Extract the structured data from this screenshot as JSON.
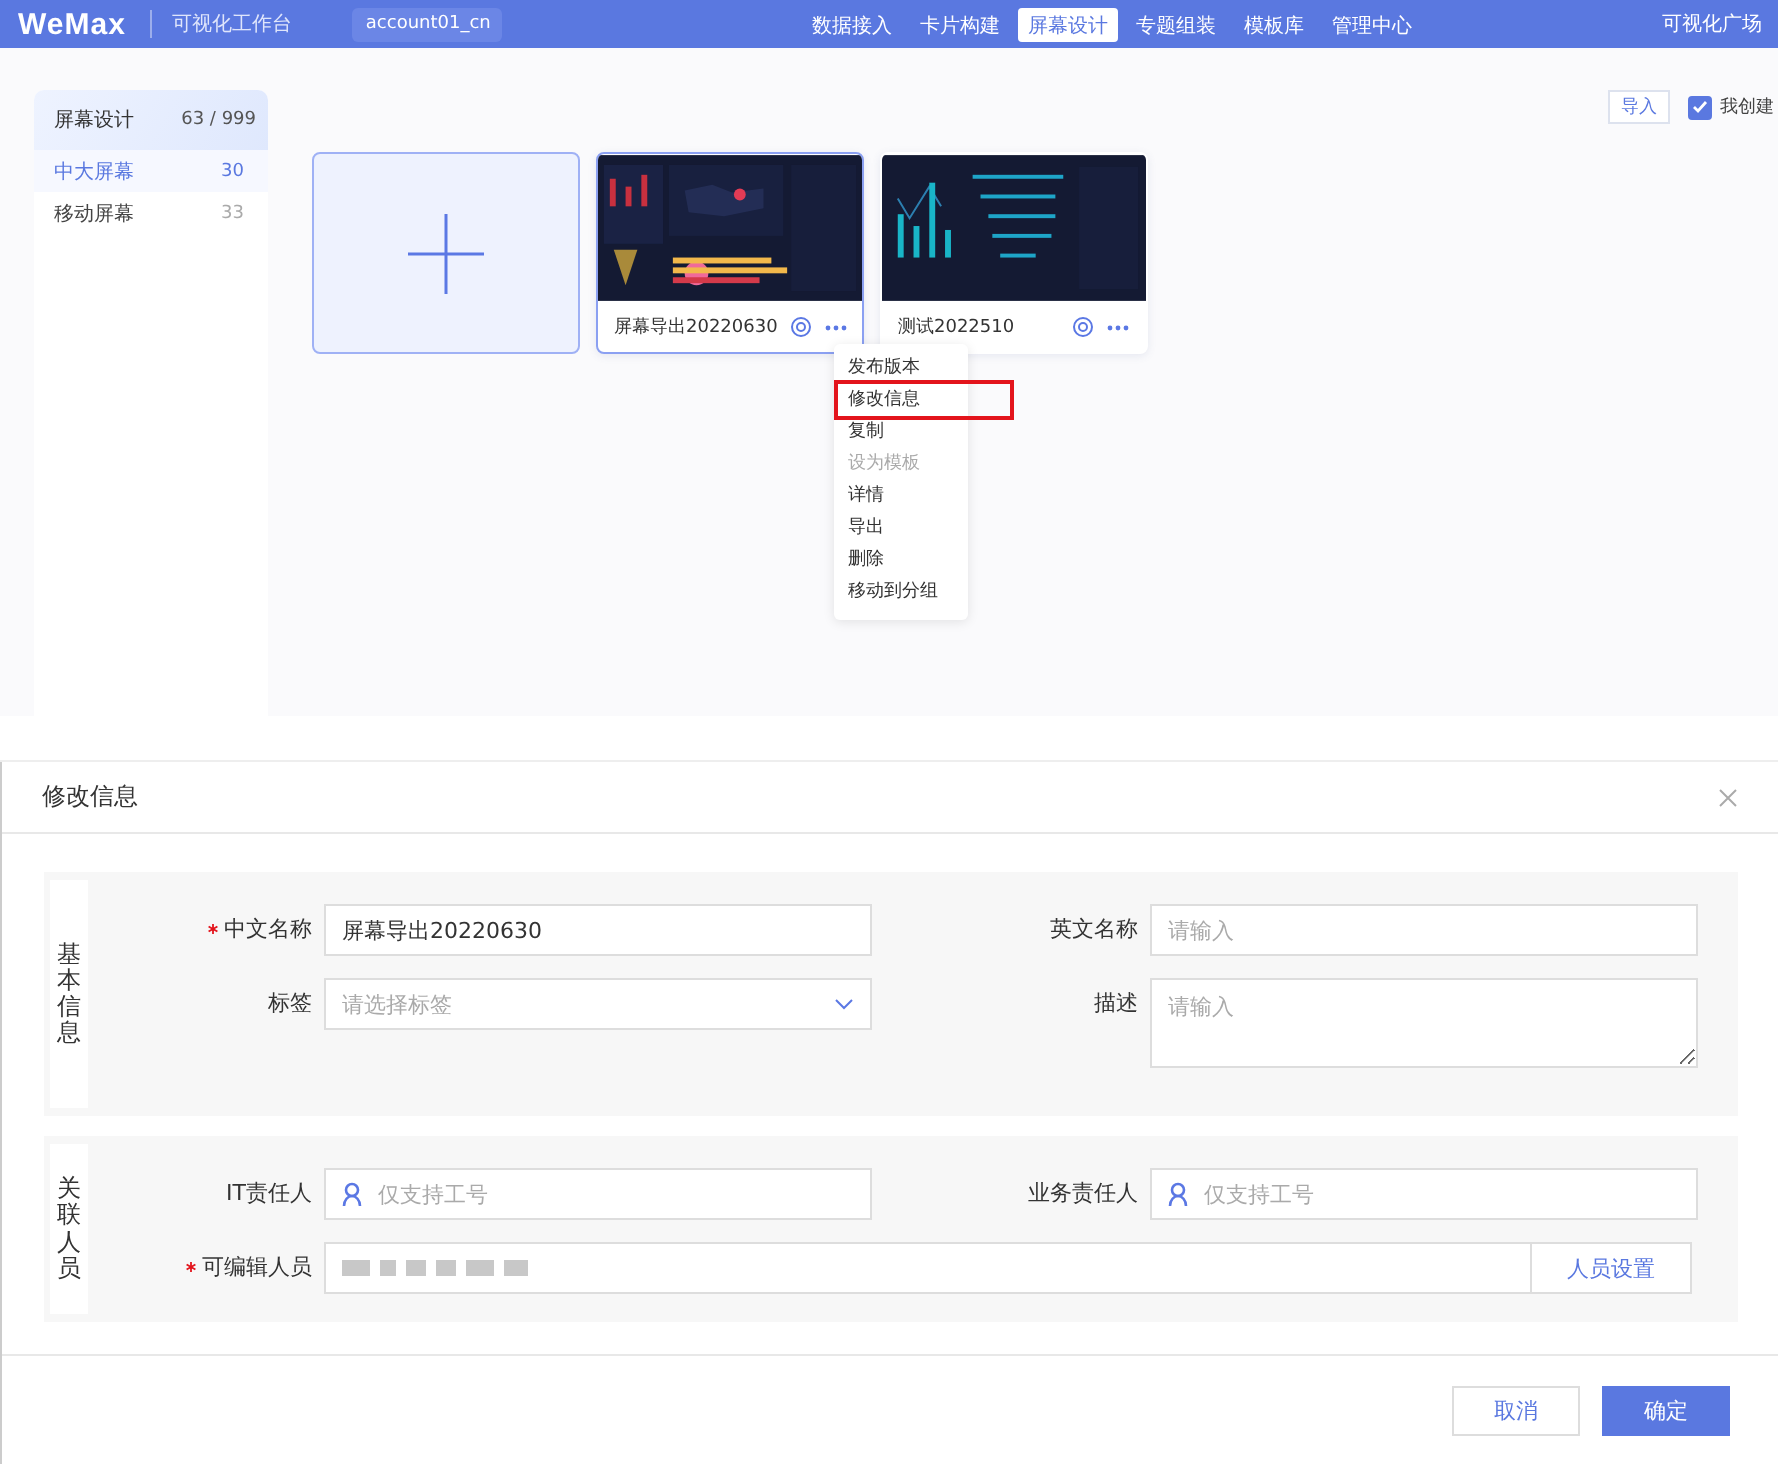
{
  "topbar": {
    "logo": "WeMax",
    "subtitle": "可视化工作台",
    "account": "account01_cn",
    "nav": [
      {
        "label": "数据接入",
        "selected": false
      },
      {
        "label": "卡片构建",
        "selected": false
      },
      {
        "label": "屏幕设计",
        "selected": true
      },
      {
        "label": "专题组装",
        "selected": false
      },
      {
        "label": "模板库",
        "selected": false
      },
      {
        "label": "管理中心",
        "selected": false
      }
    ],
    "right_link": "可视化广场"
  },
  "sidebar": {
    "title": "屏幕设计",
    "count": "63 / 999",
    "items": [
      {
        "label": "中大屏幕",
        "count": "30",
        "selected": true
      },
      {
        "label": "移动屏幕",
        "count": "33",
        "selected": false
      }
    ]
  },
  "toolbar": {
    "import_button": "导入",
    "filter": {
      "label": "我创建",
      "checked": true
    }
  },
  "cards": [
    {
      "kind": "add"
    },
    {
      "kind": "screen",
      "name": "屏幕导出20220630",
      "selected": true
    },
    {
      "kind": "screen",
      "name": "测试2022510",
      "selected": false
    }
  ],
  "context_menu": {
    "items": [
      {
        "label": "发布版本",
        "disabled": false,
        "highlighted": false
      },
      {
        "label": "修改信息",
        "disabled": false,
        "highlighted": true
      },
      {
        "label": "复制",
        "disabled": false,
        "highlighted": false
      },
      {
        "label": "设为模板",
        "disabled": true,
        "highlighted": false
      },
      {
        "label": "详情",
        "disabled": false,
        "highlighted": false
      },
      {
        "label": "导出",
        "disabled": false,
        "highlighted": false
      },
      {
        "label": "删除",
        "disabled": false,
        "highlighted": false
      },
      {
        "label": "移动到分组",
        "disabled": false,
        "highlighted": false
      }
    ]
  },
  "dialog": {
    "title": "修改信息",
    "sections": [
      {
        "title": "基本信息",
        "fields": [
          {
            "kind": "input",
            "label": "中文名称",
            "required": true,
            "value": "屏幕导出20220630"
          },
          {
            "kind": "input",
            "label": "英文名称",
            "required": false,
            "placeholder": "请输入"
          },
          {
            "kind": "select",
            "label": "标签",
            "required": false,
            "placeholder": "请选择标签"
          },
          {
            "kind": "textarea",
            "label": "描述",
            "required": false,
            "placeholder": "请输入"
          }
        ]
      },
      {
        "title": "关联人员",
        "fields": [
          {
            "kind": "person",
            "label": "IT责任人",
            "required": false,
            "placeholder": "仅支持工号"
          },
          {
            "kind": "person",
            "label": "业务责任人",
            "required": false,
            "placeholder": "仅支持工号"
          },
          {
            "kind": "people",
            "label": "可编辑人员",
            "required": true,
            "button": "人员设置"
          }
        ]
      }
    ],
    "buttons": [
      {
        "label": "取消",
        "kind": "secondary"
      },
      {
        "label": "确定",
        "kind": "primary"
      }
    ]
  }
}
